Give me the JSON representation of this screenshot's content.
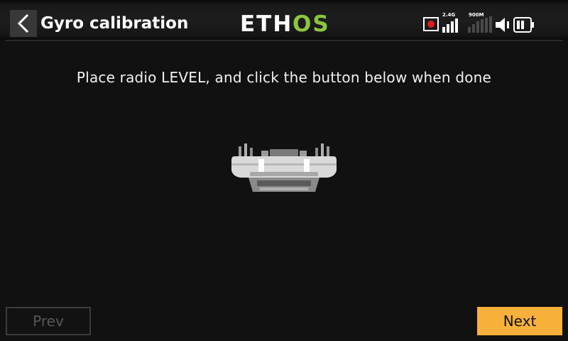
{
  "header": {
    "title": "Gyro calibration",
    "back_icon": "chevron-left-icon",
    "logo": {
      "text_eth": "ETH",
      "text_os": "OS",
      "color_eth": "#ffffff",
      "color_os": "#8cc63f"
    },
    "status": {
      "record_icon": "record-icon",
      "record_color": "#e01b1b",
      "signal_24g_label": "2.4G",
      "signal_900m_label": "900M",
      "speaker_icon": "speaker-icon",
      "battery_icon": "battery-icon"
    }
  },
  "main": {
    "instruction": "Place radio LEVEL, and click the button below when done",
    "image_icon": "radio-transmitter-image"
  },
  "footer": {
    "prev_label": "Prev",
    "next_label": "Next",
    "accent_color": "#f7b03a"
  }
}
